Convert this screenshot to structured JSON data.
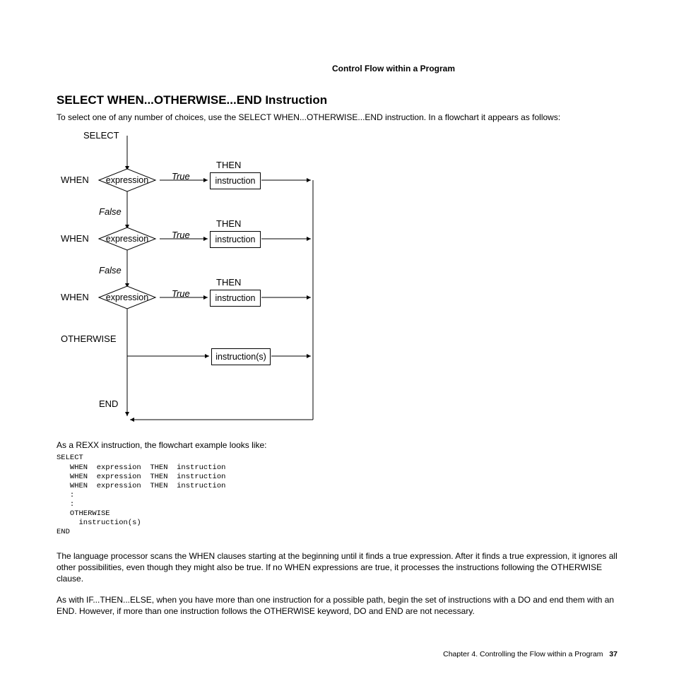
{
  "runningHead": "Control Flow within a Program",
  "title": "SELECT WHEN...OTHERWISE...END Instruction",
  "intro": "To select one of any number of choices, use the SELECT  WHEN...OTHERWISE...END instruction. In a flowchart it appears as follows:",
  "flow": {
    "select": "SELECT",
    "when": "WHEN",
    "expression": "expression",
    "true": "True",
    "false": "False",
    "then": "THEN",
    "instruction": "instruction",
    "otherwise": "OTHERWISE",
    "instructions": "instruction(s)",
    "end": "END"
  },
  "afterFlow": "As a REXX instruction, the flowchart example looks like:",
  "code": "SELECT\n   WHEN  expression  THEN  instruction\n   WHEN  expression  THEN  instruction\n   WHEN  expression  THEN  instruction\n   :\n   :\n   OTHERWISE\n     instruction(s)\nEND",
  "para1": "The language processor scans the WHEN clauses starting at the beginning until it finds a true expression. After it finds a true expression, it ignores all other possibilities, even though they might also be true. If no WHEN expressions are true, it processes the instructions following the OTHERWISE clause.",
  "para2": "As with IF...THEN...ELSE, when you have more than one instruction for a possible path, begin the set of instructions with a DO and end them with an END. However, if more than one instruction follows the OTHERWISE keyword, DO and END are not necessary.",
  "footer": {
    "chapter": "Chapter 4. Controlling the Flow within a Program",
    "page": "37"
  }
}
